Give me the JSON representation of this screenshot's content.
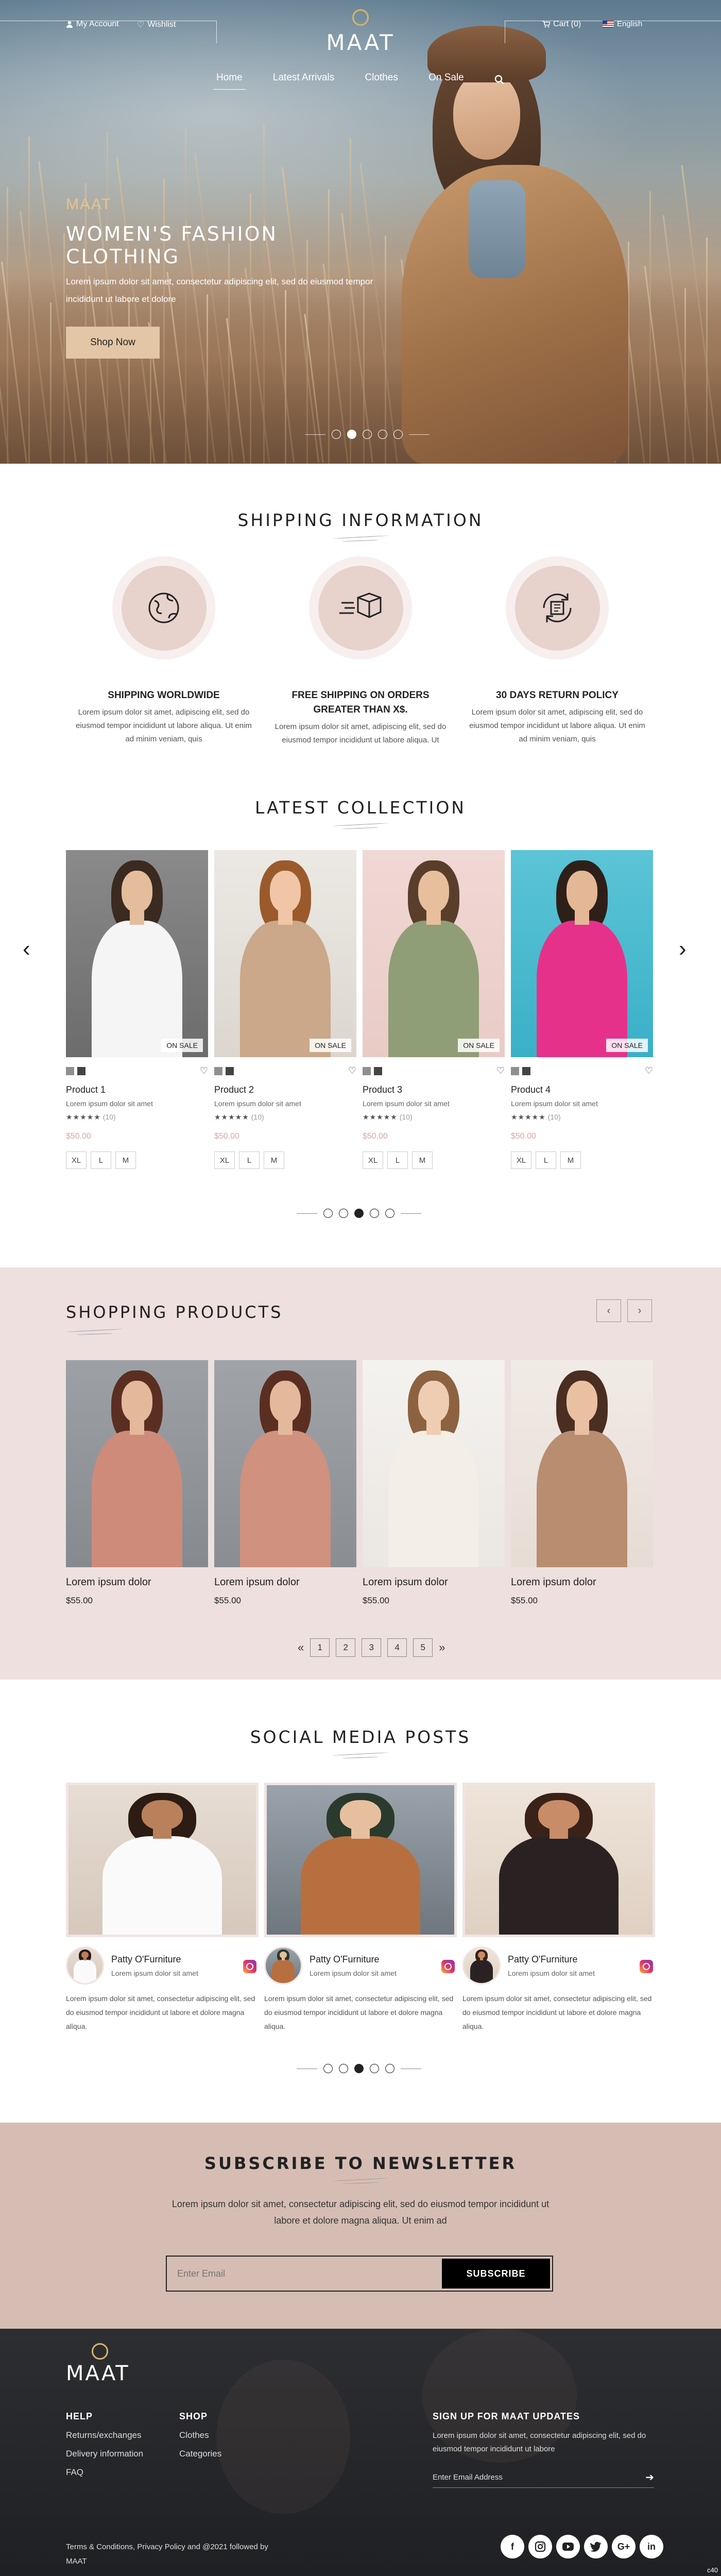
{
  "header": {
    "my_account": "My Account",
    "wishlist": "Wishlist",
    "logo": "MAAT",
    "cart": "Cart (0)",
    "language": "English",
    "nav": [
      "Home",
      "Latest Arrivals",
      "Clothes",
      "On Sale"
    ]
  },
  "hero": {
    "brand": "MAAT",
    "title": "WOMEN'S FASHION CLOTHING",
    "desc": "Lorem ipsum dolor sit amet, consectetur adipiscing elit, sed do eiusmod tempor incididunt ut labore et dolore",
    "button": "Shop Now",
    "slides": 5,
    "active_slide": 1
  },
  "shipping": {
    "title": "SHIPPING INFORMATION",
    "items": [
      {
        "icon": "globe-icon",
        "title": "SHIPPING WORLDWIDE",
        "text": "Lorem ipsum dolor sit amet, adipiscing elit, sed do eiusmod tempor incididunt ut labore aliqua. Ut enim ad minim veniam, quis"
      },
      {
        "icon": "fast-delivery-icon",
        "title": "FREE SHIPPING ON ORDERS GREATER THAN X$.",
        "text": "Lorem ipsum dolor sit amet, adipiscing elit, sed do eiusmod tempor incididunt ut labore aliqua. Ut"
      },
      {
        "icon": "return-policy-icon",
        "title": "30 DAYS RETURN POLICY",
        "text": "Lorem ipsum dolor sit amet, adipiscing elit, sed do eiusmod tempor incididunt ut labore aliqua. Ut enim ad minim veniam, quis"
      }
    ]
  },
  "latest": {
    "title": "LATEST COLLECTION",
    "products": [
      {
        "name": "Product 1",
        "desc": "Lorem ipsum dolor sit amet",
        "stars": "★★★★★",
        "reviews": "(10)",
        "price": "$50.00",
        "badge": "ON SALE",
        "sizes": [
          "XL",
          "L",
          "M"
        ],
        "swatches": [
          "#8f8f8f",
          "#444444"
        ]
      },
      {
        "name": "Product 2",
        "desc": "Lorem ipsum dolor sit amet",
        "stars": "★★★★★",
        "reviews": "(10)",
        "price": "$50.00",
        "badge": "ON SALE",
        "sizes": [
          "XL",
          "L",
          "M"
        ],
        "swatches": [
          "#8f8f8f",
          "#444444"
        ]
      },
      {
        "name": "Product 3",
        "desc": "Lorem ipsum dolor sit amet",
        "stars": "★★★★★",
        "reviews": "(10)",
        "price": "$50.00",
        "badge": "ON SALE",
        "sizes": [
          "XL",
          "L",
          "M"
        ],
        "swatches": [
          "#8f8f8f",
          "#444444"
        ]
      },
      {
        "name": "Product 4",
        "desc": "Lorem ipsum dolor sit amet",
        "stars": "★★★★★",
        "reviews": "(10)",
        "price": "$50.00",
        "badge": "ON SALE",
        "sizes": [
          "XL",
          "L",
          "M"
        ],
        "swatches": [
          "#8f8f8f",
          "#444444"
        ]
      }
    ],
    "active_slide": 2
  },
  "shopping": {
    "title": "SHOPPING PRODUCTS",
    "products": [
      {
        "name": "Lorem ipsum dolor",
        "price": "$55.00"
      },
      {
        "name": "Lorem ipsum dolor",
        "price": "$55.00"
      },
      {
        "name": "Lorem ipsum dolor",
        "price": "$55.00"
      },
      {
        "name": "Lorem ipsum dolor",
        "price": "$55.00"
      }
    ],
    "pages": [
      "1",
      "2",
      "3",
      "4",
      "5"
    ]
  },
  "social": {
    "title": "SOCIAL MEDIA POSTS",
    "posts": [
      {
        "author": "Patty O'Furniture",
        "sub": "Lorem ipsum dolor sit amet",
        "text": "Lorem ipsum dolor sit amet, consectetur adipiscing elit, sed do eiusmod tempor incididunt ut labore et dolore magna aliqua."
      },
      {
        "author": "Patty O'Furniture",
        "sub": "Lorem ipsum dolor sit amet",
        "text": "Lorem ipsum dolor sit amet, consectetur adipiscing elit, sed do eiusmod tempor incididunt ut labore et dolore magna aliqua."
      },
      {
        "author": "Patty O'Furniture",
        "sub": "Lorem ipsum dolor sit amet",
        "text": "Lorem ipsum dolor sit amet, consectetur adipiscing elit, sed do eiusmod tempor incididunt ut labore et dolore magna aliqua."
      }
    ],
    "active_slide": 2
  },
  "newsletter": {
    "title": "SUBSCRIBE TO NEWSLETTER",
    "desc": "Lorem ipsum dolor sit amet, consectetur adipiscing elit, sed do eiusmod tempor incididunt ut labore et dolore magna aliqua. Ut enim ad",
    "placeholder": "Enter Email",
    "button": "SUBSCRIBE"
  },
  "footer": {
    "logo": "MAAT",
    "help_title": "HELP",
    "help_links": [
      "Returns/exchanges",
      "Delivery information",
      "FAQ"
    ],
    "shop_title": "SHOP",
    "shop_links": [
      "Clothes",
      "Categories"
    ],
    "signup_title": "SIGN UP FOR MAAT UPDATES",
    "signup_text": "Lorem ipsum dolor sit amet, consectetur adipiscing elit, sed do eiusmod tempor incididunt ut labore",
    "email_placeholder": "Enter Email Address",
    "copyright": "Terms & Conditions, Privacy Policy and @2021 followed by MAAT",
    "social": [
      "f",
      "ig",
      "yt",
      "tw",
      "G+",
      "in"
    ],
    "version": "c40"
  },
  "colors": {
    "accent": "#d8b46a",
    "button": "#e3c6a5",
    "price": "#d8a89e",
    "shop_bg": "#ede0df",
    "newsletter_bg": "#d6bdb4",
    "footer_bg": "#2d2e31"
  }
}
